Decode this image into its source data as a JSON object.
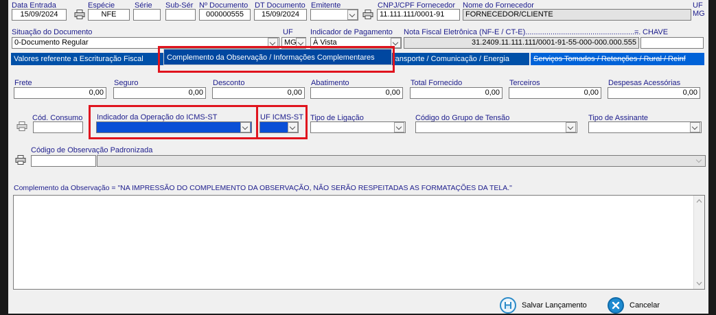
{
  "header": {
    "data_entrada_label": "Data Entrada",
    "data_entrada_value": "15/09/2024",
    "especie_label": "Espécie",
    "especie_value": "NFE",
    "serie_label": "Série",
    "serie_value": "",
    "subserie_label": "Sub-Sér",
    "subserie_value": "",
    "num_doc_label": "Nº Documento",
    "num_doc_value": "000000555",
    "dt_doc_label": "DT Documento",
    "dt_doc_value": "15/09/2024",
    "emitente_label": "Emitente",
    "emitente_value": "",
    "cnpj_label": "CNPJ/CPF Fornecedor",
    "cnpj_value": "11.111.111/0001-91",
    "fornecedor_label": "Nome do Fornecedor",
    "fornecedor_value": "FORNECEDOR/CLIENTE",
    "uf_label": "UF",
    "uf_value": "MG"
  },
  "row2": {
    "situacao_label": "Situação do Documento",
    "situacao_value": "0-Documento Regular",
    "uf_label": "UF",
    "uf_value": "MG",
    "pagamento_label": "Indicador de Pagamento",
    "pagamento_value": "À Vista",
    "nfe_label": "Nota Fiscal Eletrônica (NF-E / CT-E).......................................................",
    "nfe_eq": "=",
    "chave_label": "CHAVE",
    "nfe_value": "31.2409.11.111.111/0001-91-55-000-000.000.555",
    "chave_value": ""
  },
  "tabs": [
    {
      "label": "Valores referente a Escrituração Fiscal"
    },
    {
      "label": "Complemento da Observação / Informações Complementares"
    },
    {
      "label": "ransporte / Comunicação / Energia"
    },
    {
      "label": "Serviços Tomados / Retenções / Rural / Reinf"
    }
  ],
  "valores": [
    {
      "label": "Frete",
      "value": "0,00"
    },
    {
      "label": "Seguro",
      "value": "0,00"
    },
    {
      "label": "Desconto",
      "value": "0,00"
    },
    {
      "label": "Abatimento",
      "value": "0,00"
    },
    {
      "label": "Total Fornecido",
      "value": "0,00"
    },
    {
      "label": "Terceiros",
      "value": "0,00"
    },
    {
      "label": "Despesas Acessórias",
      "value": "0,00"
    }
  ],
  "consumo": {
    "cod_consumo_label": "Cód. Consumo",
    "indicador_label": "Indicador da Operação do ICMS-ST",
    "uf_icms_label": "UF ICMS-ST",
    "tipo_ligacao_label": "Tipo de Ligação",
    "grupo_tensao_label": "Código do Grupo de Tensão",
    "tipo_assinante_label": "Tipo de Assinante"
  },
  "obs": {
    "cod_obs_label": "Código de Observação Padronizada",
    "complemento_label": "Complemento da Observação = \"NA IMPRESSÃO DO COMPLEMENTO DA OBSERVAÇÃO, NÃO SERÃO RESPEITADAS AS FORMATAÇÕES DA TELA.\""
  },
  "footer": {
    "salvar_label": "Salvar Lançamento",
    "cancelar_label": "Cancelar"
  },
  "colors": {
    "tab_blue": "#0050a8",
    "highlight_red": "#e0141e",
    "label_blue": "#1c1c8c"
  }
}
